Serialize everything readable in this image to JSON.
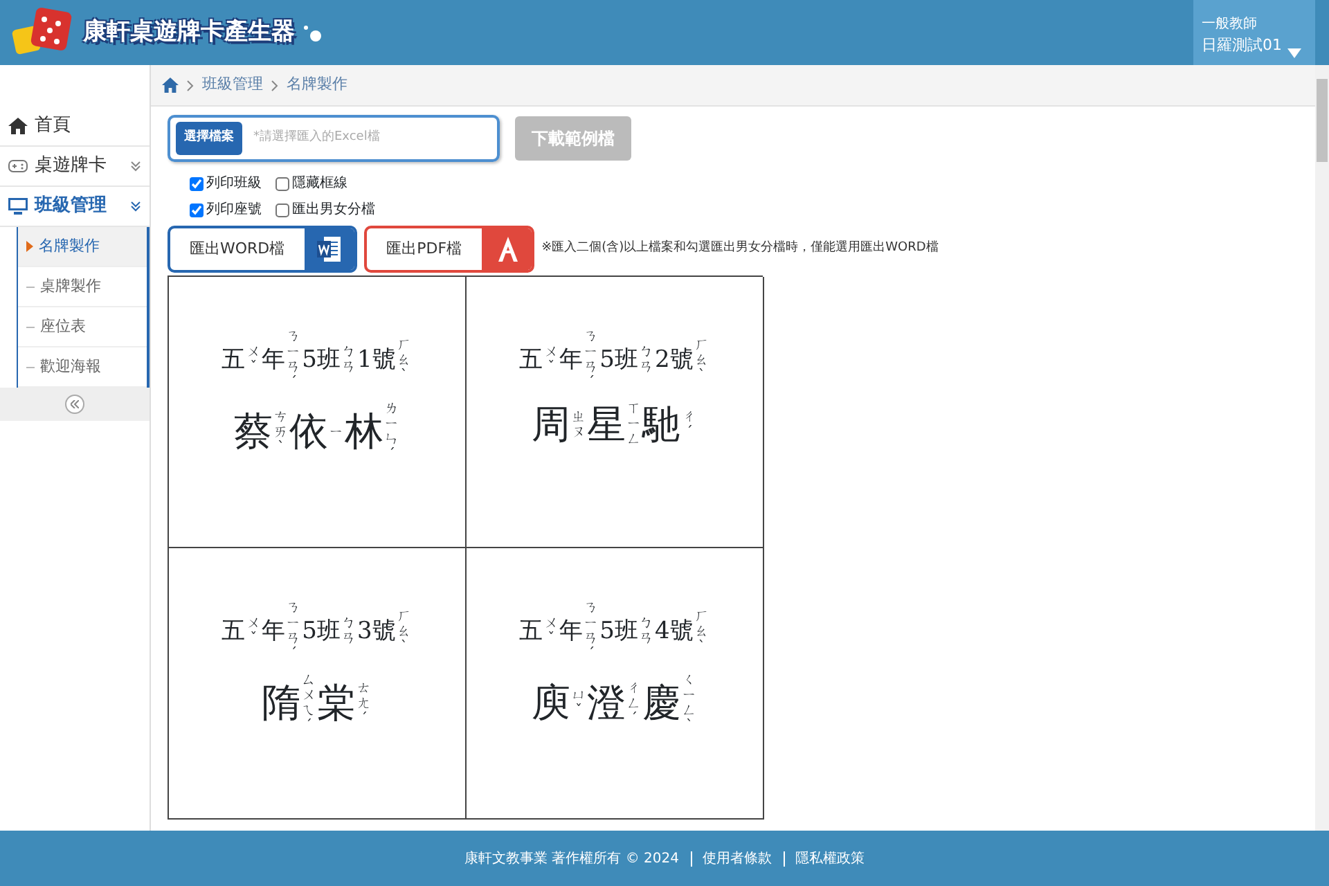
{
  "header": {
    "logo_text": "康軒桌遊牌卡產生器",
    "user": {
      "role": "一般教師",
      "name": "日羅測試01"
    }
  },
  "breadcrumb": [
    "班級管理",
    "名牌製作"
  ],
  "sidebar": {
    "items": [
      {
        "label": "首頁",
        "kind": "home",
        "selected": false
      },
      {
        "label": "桌遊牌卡",
        "kind": "gamepad",
        "selected": false,
        "expanded": false
      },
      {
        "label": "班級管理",
        "kind": "monitor",
        "selected": true,
        "expanded": true,
        "children": [
          {
            "label": "名牌製作",
            "selected": true
          },
          {
            "label": "桌牌製作",
            "selected": false
          },
          {
            "label": "座位表",
            "selected": false
          },
          {
            "label": "歡迎海報",
            "selected": false
          }
        ]
      }
    ]
  },
  "file_picker": {
    "button": "選擇檔案",
    "placeholder": "*請選擇匯入的Excel檔"
  },
  "download_button": {
    "label": "下載範例檔",
    "disabled": true
  },
  "options": [
    {
      "label": "列印班級",
      "checked": true
    },
    {
      "label": "隱藏框線",
      "checked": false
    },
    {
      "label": "列印座號",
      "checked": true
    },
    {
      "label": "匯出男女分檔",
      "checked": false
    }
  ],
  "export_buttons": [
    {
      "label": "匯出WORD檔",
      "kind": "word"
    },
    {
      "label": "匯出PDF檔",
      "kind": "pdf"
    }
  ],
  "export_note": "※匯入二個(含)以上檔案和勾選匯出男女分檔時，僅能選用匯出WORD檔",
  "cards": [
    {
      "class_line": [
        {
          "text": "五",
          "zhuyin": "ㄨˇ"
        },
        {
          "text": "年",
          "zhuyin": "ㄋㄧㄢˊ"
        },
        {
          "text": "5"
        },
        {
          "text": "班",
          "zhuyin": "ㄅㄢ"
        },
        {
          "text": "1"
        },
        {
          "text": "號",
          "zhuyin": "ㄏㄠˋ"
        }
      ],
      "name": [
        {
          "text": "蔡",
          "zhuyin": "ㄘㄞˋ"
        },
        {
          "text": "依",
          "zhuyin": "ㄧ"
        },
        {
          "text": "林",
          "zhuyin": "ㄌㄧㄣˊ"
        }
      ]
    },
    {
      "class_line": [
        {
          "text": "五",
          "zhuyin": "ㄨˇ"
        },
        {
          "text": "年",
          "zhuyin": "ㄋㄧㄢˊ"
        },
        {
          "text": "5"
        },
        {
          "text": "班",
          "zhuyin": "ㄅㄢ"
        },
        {
          "text": "2"
        },
        {
          "text": "號",
          "zhuyin": "ㄏㄠˋ"
        }
      ],
      "name": [
        {
          "text": "周",
          "zhuyin": "ㄓㄡ"
        },
        {
          "text": "星",
          "zhuyin": "ㄒㄧㄥ"
        },
        {
          "text": "馳",
          "zhuyin": "ㄔˊ"
        }
      ]
    },
    {
      "class_line": [
        {
          "text": "五",
          "zhuyin": "ㄨˇ"
        },
        {
          "text": "年",
          "zhuyin": "ㄋㄧㄢˊ"
        },
        {
          "text": "5"
        },
        {
          "text": "班",
          "zhuyin": "ㄅㄢ"
        },
        {
          "text": "3"
        },
        {
          "text": "號",
          "zhuyin": "ㄏㄠˋ"
        }
      ],
      "name": [
        {
          "text": "隋",
          "zhuyin": "ㄙㄨㄟˊ"
        },
        {
          "text": "棠",
          "zhuyin": "ㄊㄤˊ"
        }
      ]
    },
    {
      "class_line": [
        {
          "text": "五",
          "zhuyin": "ㄨˇ"
        },
        {
          "text": "年",
          "zhuyin": "ㄋㄧㄢˊ"
        },
        {
          "text": "5"
        },
        {
          "text": "班",
          "zhuyin": "ㄅㄢ"
        },
        {
          "text": "4"
        },
        {
          "text": "號",
          "zhuyin": "ㄏㄠˋ"
        }
      ],
      "name": [
        {
          "text": "庾",
          "zhuyin": "ㄩˇ"
        },
        {
          "text": "澄",
          "zhuyin": "ㄔㄥˊ"
        },
        {
          "text": "慶",
          "zhuyin": "ㄑㄧㄥˋ"
        }
      ]
    }
  ],
  "footer": {
    "copyright": "康軒文教事業 著作權所有 © 2024",
    "links": [
      "使用者條款",
      "隱私權政策"
    ]
  }
}
